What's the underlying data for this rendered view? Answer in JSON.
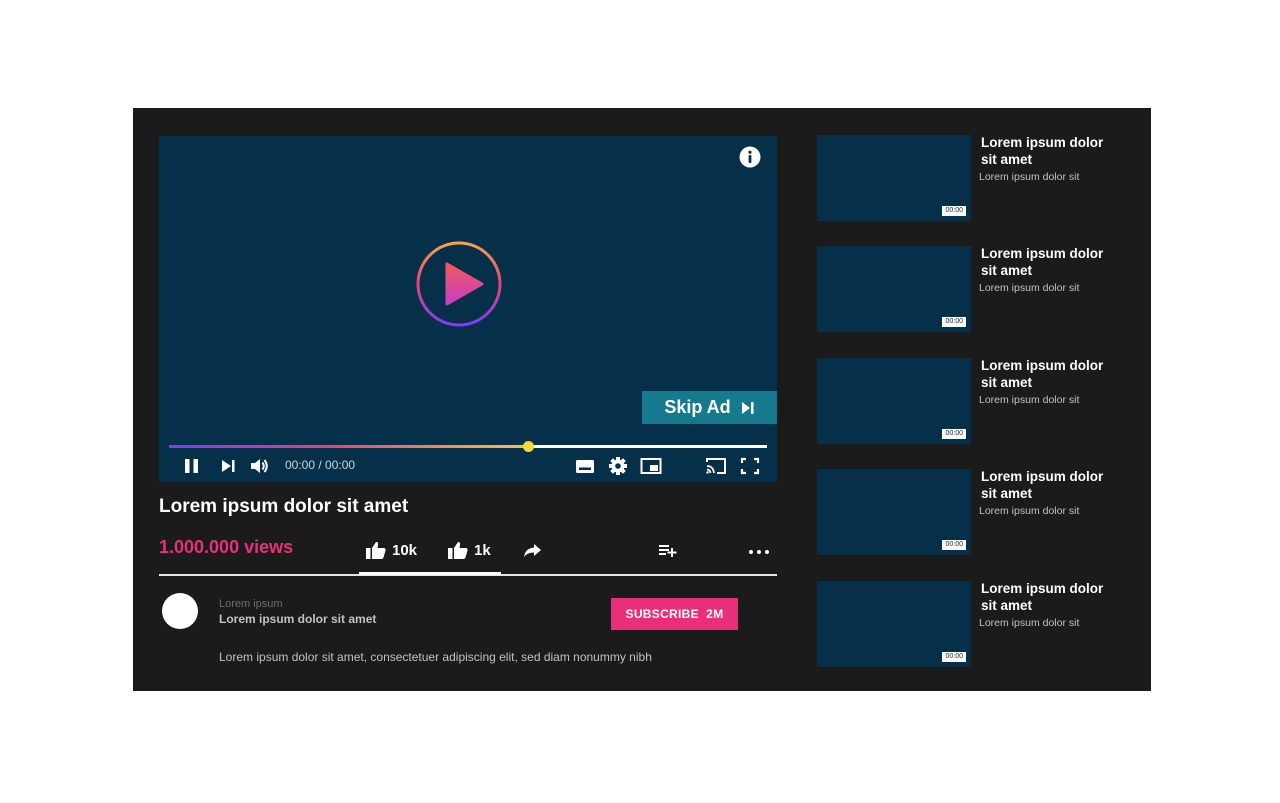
{
  "player": {
    "skip_ad_label": "Skip Ad",
    "time_display": "00:00 / 00:00",
    "progress": 0.6,
    "progress_gradient": [
      "#7a3cff",
      "#e8407a",
      "#f4c542"
    ],
    "icons": [
      "info-icon",
      "play-icon",
      "pause-icon",
      "next-icon",
      "volume-icon",
      "subtitles-icon",
      "gear-icon",
      "miniplayer-icon",
      "cast-icon",
      "fullscreen-icon",
      "skip-next-icon"
    ]
  },
  "video": {
    "title": "Lorem ipsum dolor sit amet",
    "views": "1.000.000 views",
    "likes": "10k",
    "dislikes": "1k",
    "icons": [
      "thumb-up-icon",
      "thumb-up-icon",
      "share-icon",
      "add-to-playlist-icon",
      "more-icon"
    ]
  },
  "channel": {
    "name": "Lorem ipsum",
    "description": "Lorem ipsum dolor sit amet",
    "subscribe_label": "SUBSCRIBE  2M",
    "video_description": "Lorem ipsum dolor sit amet, consectetuer adipiscing elit, sed diam nonummy nibh"
  },
  "recommendations": [
    {
      "title": "Lorem ipsum dolor sit amet",
      "channel": "Lorem ipsum dolor sit",
      "duration": "00:00"
    },
    {
      "title": "Lorem ipsum dolor sit amet",
      "channel": "Lorem ipsum dolor sit",
      "duration": "00:00"
    },
    {
      "title": "Lorem ipsum dolor sit amet",
      "channel": "Lorem ipsum dolor sit",
      "duration": "00:00"
    },
    {
      "title": "Lorem ipsum dolor sit amet",
      "channel": "Lorem ipsum dolor sit",
      "duration": "00:00"
    },
    {
      "title": "Lorem ipsum dolor sit amet",
      "channel": "Lorem ipsum dolor sit",
      "duration": "00:00"
    }
  ],
  "colors": {
    "background": "#1b1b1c",
    "player_background": "#06304a",
    "accent_pink": "#e8307a",
    "skip_ad_teal": "#167a8f",
    "progress_knob": "#f4d742"
  }
}
